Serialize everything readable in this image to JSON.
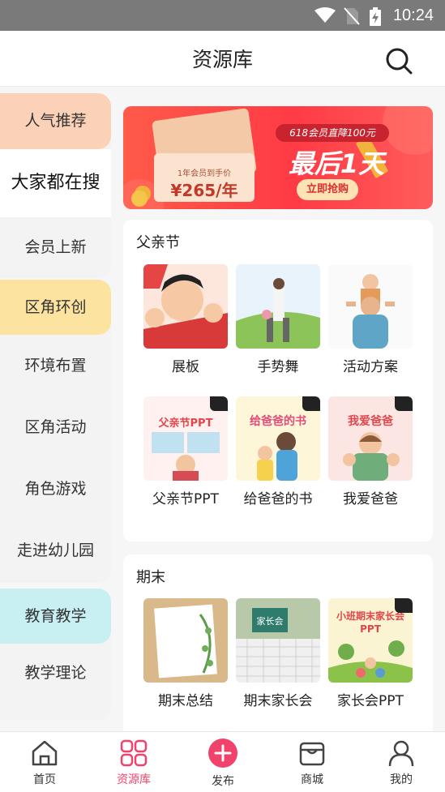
{
  "status_bar": {
    "time": "10:24"
  },
  "header": {
    "title": "资源库"
  },
  "sidebar": {
    "items": [
      {
        "label": "人气推荐",
        "kind": "group"
      },
      {
        "label": "大家都在搜",
        "kind": "active"
      },
      {
        "label": "会员上新",
        "kind": "item"
      },
      {
        "label": "区角环创",
        "kind": "group"
      },
      {
        "label": "环境布置",
        "kind": "item"
      },
      {
        "label": "区角活动",
        "kind": "item"
      },
      {
        "label": "角色游戏",
        "kind": "item"
      },
      {
        "label": "走进幼儿园",
        "kind": "item"
      },
      {
        "label": "教育教学",
        "kind": "group"
      },
      {
        "label": "教学理论",
        "kind": "item"
      }
    ]
  },
  "banner": {
    "promo_line": "618会员直降100元",
    "headline": "最后1天",
    "cta": "立即抢购",
    "price_note": "1年会员到手价",
    "price": "¥265/年"
  },
  "sections": [
    {
      "title": "父亲节",
      "items": [
        {
          "label": "展板",
          "vip": false
        },
        {
          "label": "手势舞",
          "vip": false
        },
        {
          "label": "活动方案",
          "vip": false
        },
        {
          "label": "父亲节PPT",
          "vip": true,
          "cover_text": "父亲节PPT"
        },
        {
          "label": "给爸爸的书",
          "vip": true,
          "cover_text": "给爸爸的书"
        },
        {
          "label": "我爱爸爸",
          "vip": true,
          "cover_text": "我爱爸爸"
        }
      ]
    },
    {
      "title": "期末",
      "items": [
        {
          "label": "期末总结",
          "vip": false
        },
        {
          "label": "期末家长会",
          "vip": false,
          "cover_text": "家长会"
        },
        {
          "label": "家长会PPT",
          "vip": true,
          "cover_text": "小班期末家长会 PPT"
        }
      ]
    }
  ],
  "tabbar": {
    "items": [
      {
        "label": "首页",
        "active": false
      },
      {
        "label": "资源库",
        "active": true
      },
      {
        "label": "发布",
        "active": false
      },
      {
        "label": "商城",
        "active": false
      },
      {
        "label": "我的",
        "active": false
      }
    ]
  },
  "colors": {
    "accent": "#f0426b",
    "group_peach": "#fbd2b8",
    "group_yellow": "#fde3a0",
    "group_cyan": "#c8f0f3",
    "banner_red": "#ff4b47"
  }
}
